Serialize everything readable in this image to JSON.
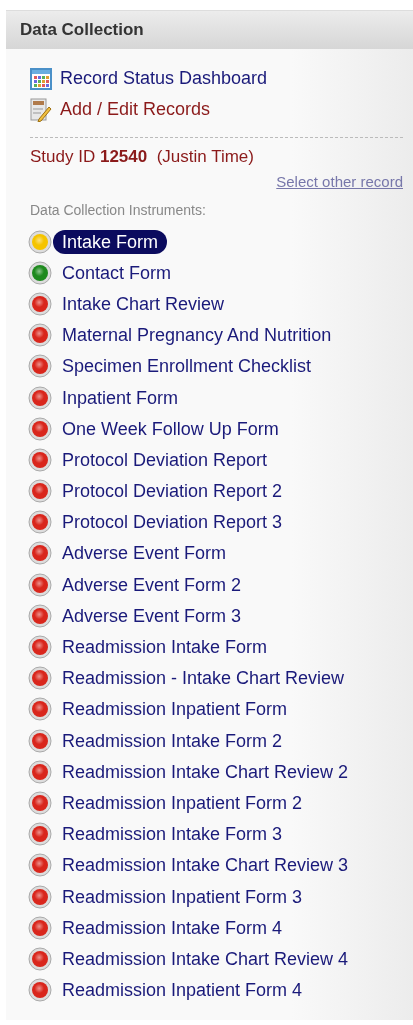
{
  "panel": {
    "title": "Data Collection"
  },
  "links": [
    {
      "kind": "dashboard",
      "label": "Record Status Dashboard"
    },
    {
      "kind": "edit",
      "label": "Add / Edit Records"
    }
  ],
  "record": {
    "prefix": "Study ID",
    "id": "12540",
    "name": "(Justin Time)",
    "select_link": "Select other record"
  },
  "instruments_label": "Data Collection Instruments:",
  "instruments": [
    {
      "label": "Intake Form",
      "color": "#f5c400",
      "selected": true
    },
    {
      "label": "Contact Form",
      "color": "#1e8a1e",
      "selected": false
    },
    {
      "label": "Intake Chart Review",
      "color": "#d9261c",
      "selected": false
    },
    {
      "label": "Maternal Pregnancy And Nutrition",
      "color": "#d9261c",
      "selected": false
    },
    {
      "label": "Specimen Enrollment Checklist",
      "color": "#d9261c",
      "selected": false
    },
    {
      "label": "Inpatient Form",
      "color": "#d9261c",
      "selected": false
    },
    {
      "label": "One Week Follow Up Form",
      "color": "#d9261c",
      "selected": false
    },
    {
      "label": "Protocol Deviation Report",
      "color": "#d9261c",
      "selected": false
    },
    {
      "label": "Protocol Deviation Report 2",
      "color": "#d9261c",
      "selected": false
    },
    {
      "label": "Protocol Deviation Report 3",
      "color": "#d9261c",
      "selected": false
    },
    {
      "label": "Adverse Event Form",
      "color": "#d9261c",
      "selected": false
    },
    {
      "label": "Adverse Event Form 2",
      "color": "#d9261c",
      "selected": false
    },
    {
      "label": "Adverse Event Form 3",
      "color": "#d9261c",
      "selected": false
    },
    {
      "label": "Readmission Intake Form",
      "color": "#d9261c",
      "selected": false
    },
    {
      "label": "Readmission - Intake Chart Review",
      "color": "#d9261c",
      "selected": false
    },
    {
      "label": "Readmission Inpatient Form",
      "color": "#d9261c",
      "selected": false
    },
    {
      "label": "Readmission Intake Form 2",
      "color": "#d9261c",
      "selected": false
    },
    {
      "label": "Readmission Intake Chart Review 2",
      "color": "#d9261c",
      "selected": false
    },
    {
      "label": "Readmission Inpatient Form 2",
      "color": "#d9261c",
      "selected": false
    },
    {
      "label": "Readmission Intake Form 3",
      "color": "#d9261c",
      "selected": false
    },
    {
      "label": "Readmission Intake Chart Review 3",
      "color": "#d9261c",
      "selected": false
    },
    {
      "label": "Readmission Inpatient Form 3",
      "color": "#d9261c",
      "selected": false
    },
    {
      "label": "Readmission Intake Form 4",
      "color": "#d9261c",
      "selected": false
    },
    {
      "label": "Readmission Intake Chart Review 4",
      "color": "#d9261c",
      "selected": false
    },
    {
      "label": "Readmission Inpatient Form 4",
      "color": "#d9261c",
      "selected": false
    }
  ]
}
